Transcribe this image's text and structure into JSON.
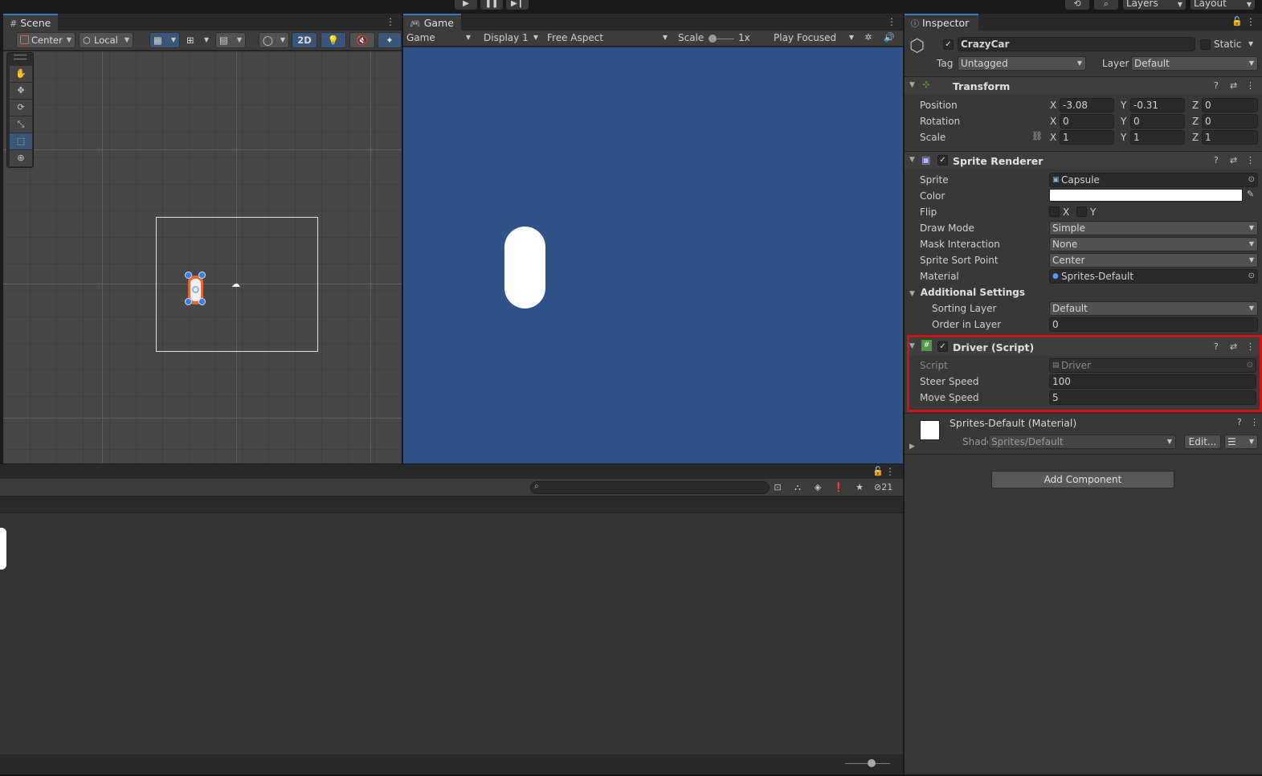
{
  "toolbar": {
    "layers_label": "Layers",
    "layout_label": "Layout"
  },
  "scene": {
    "tab_label": "Scene",
    "pivot_label": "Center",
    "space_label": "Local",
    "mode_2d_label": "2D"
  },
  "game": {
    "tab_label": "Game",
    "mode_label": "Game",
    "display_label": "Display 1",
    "aspect_label": "Free Aspect",
    "scale_label": "Scale",
    "scale_value": "1x",
    "play_mode_label": "Play Focused",
    "background_color": "#2f5388"
  },
  "console": {
    "search_placeholder": "",
    "hidden_count": "21"
  },
  "inspector": {
    "tab_label": "Inspector",
    "object_name": "CrazyCar",
    "static_label": "Static",
    "tag_label": "Tag",
    "tag_value": "Untagged",
    "layer_label": "Layer",
    "layer_value": "Default",
    "transform": {
      "title": "Transform",
      "position_label": "Position",
      "rotation_label": "Rotation",
      "scale_label": "Scale",
      "axis_x": "X",
      "axis_y": "Y",
      "axis_z": "Z",
      "position": {
        "x": "-3.08",
        "y": "-0.31",
        "z": "0"
      },
      "rotation": {
        "x": "0",
        "y": "0",
        "z": "0"
      },
      "scale": {
        "x": "1",
        "y": "1",
        "z": "1"
      }
    },
    "sprite_renderer": {
      "title": "Sprite Renderer",
      "sprite_label": "Sprite",
      "sprite_value": "Capsule",
      "color_label": "Color",
      "color_value": "#ffffff",
      "flip_label": "Flip",
      "flip_x": "X",
      "flip_y": "Y",
      "draw_mode_label": "Draw Mode",
      "draw_mode_value": "Simple",
      "mask_label": "Mask Interaction",
      "mask_value": "None",
      "sort_point_label": "Sprite Sort Point",
      "sort_point_value": "Center",
      "material_label": "Material",
      "material_value": "Sprites-Default",
      "additional_label": "Additional Settings",
      "sorting_layer_label": "Sorting Layer",
      "sorting_layer_value": "Default",
      "order_label": "Order in Layer",
      "order_value": "0"
    },
    "driver": {
      "title": "Driver (Script)",
      "script_label": "Script",
      "script_value": "Driver",
      "steer_label": "Steer Speed",
      "steer_value": "100",
      "move_label": "Move Speed",
      "move_value": "5",
      "highlight_color": "#d21414"
    },
    "material": {
      "title": "Sprites-Default (Material)",
      "shader_label": "Shader",
      "shader_value": "Sprites/Default",
      "edit_label": "Edit..."
    },
    "add_component_label": "Add Component"
  }
}
